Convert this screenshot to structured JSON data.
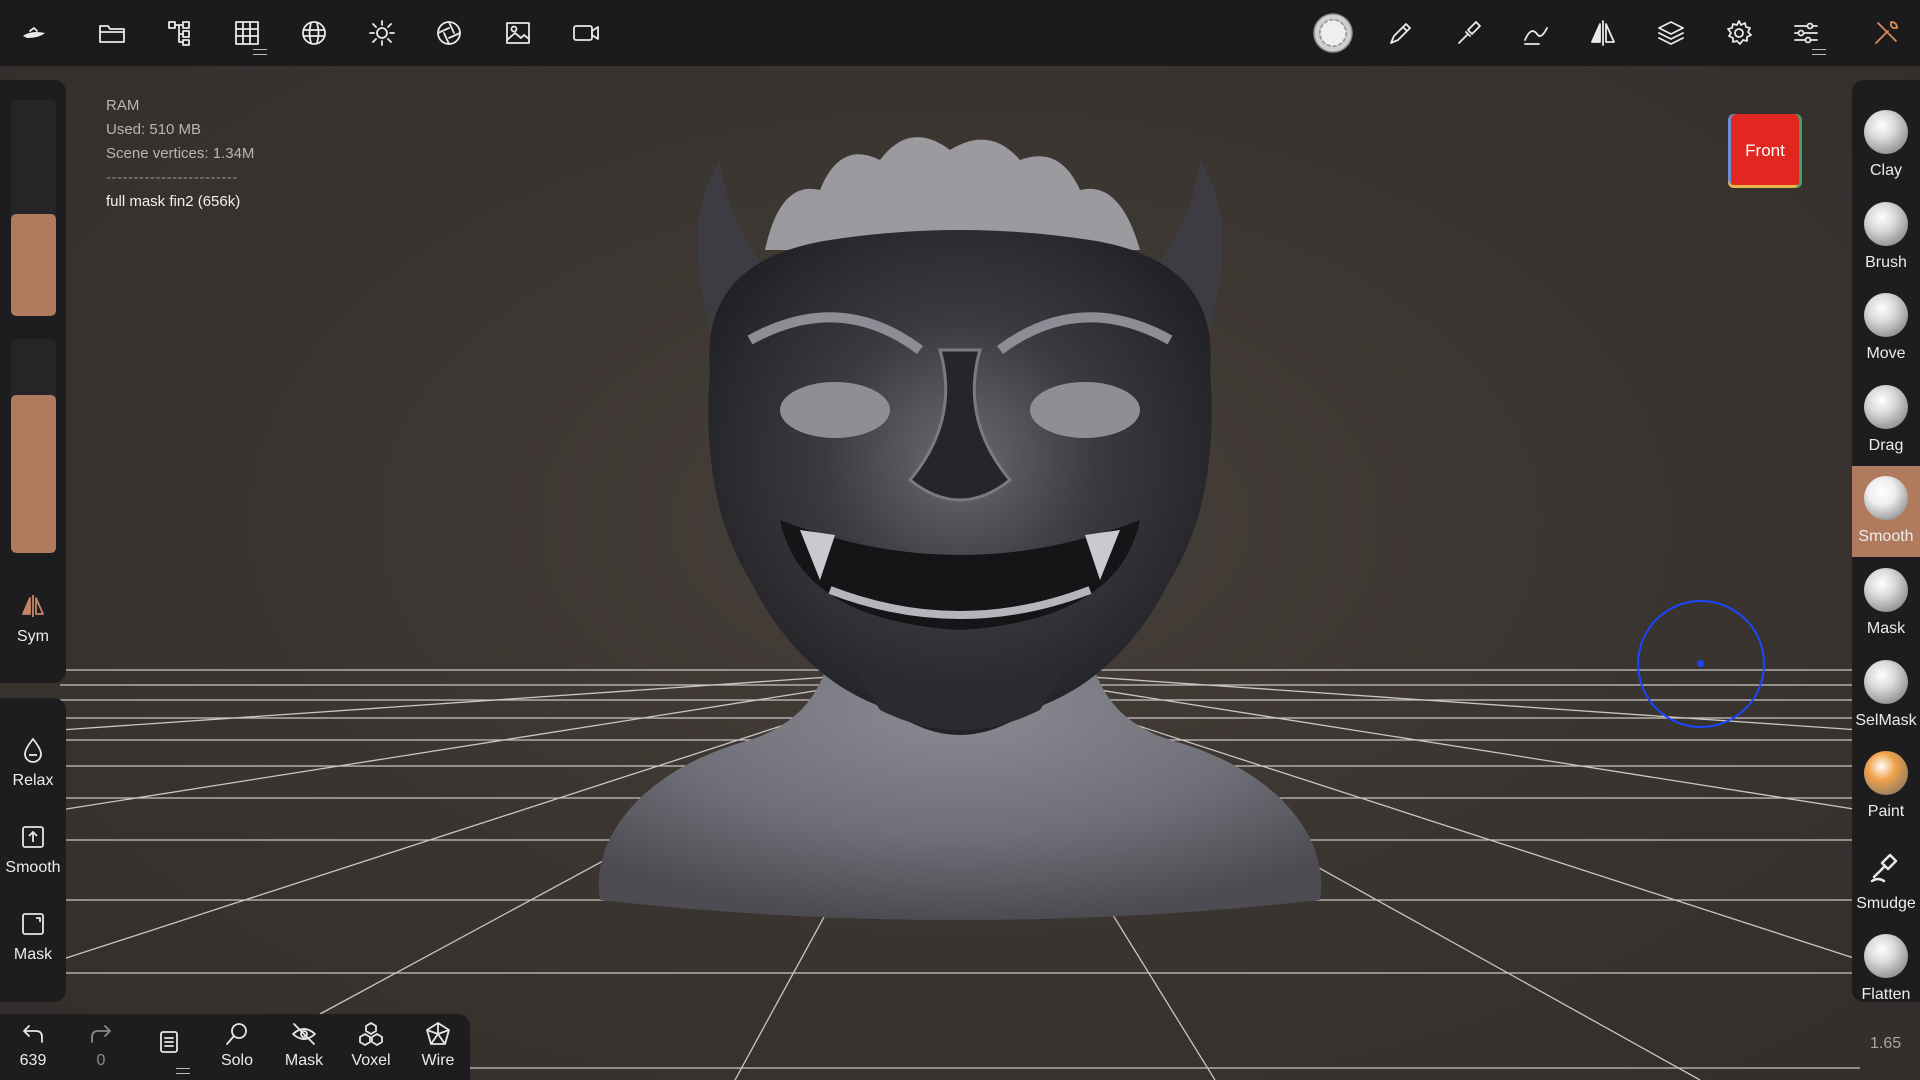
{
  "topbar": {
    "left_icons": [
      "boat-logo-icon",
      "folder-icon",
      "scene-tree-icon",
      "grid-mesh-icon",
      "sphere-topology-icon",
      "sun-icon",
      "aperture-icon",
      "image-icon",
      "video-camera-icon"
    ],
    "right_icons": [
      "material-sphere-icon",
      "pen-icon",
      "brush-tool-icon",
      "stroke-icon",
      "symmetry-icon",
      "layers-icon",
      "settings-icon",
      "sliders-icon",
      "tools-icon"
    ]
  },
  "hud": {
    "ram": "RAM",
    "used": "Used: 510 MB",
    "vertices": "Scene vertices: 1.34M",
    "separator": "------------------------",
    "object": "full mask fin2 (656k)"
  },
  "left_panel": {
    "size_slider": 0.47,
    "intensity_slider": 0.74,
    "sym_label": "Sym",
    "relax_label": "Relax",
    "smooth_label": "Smooth",
    "mask_label": "Mask"
  },
  "bottom_bar": {
    "undo_count": "639",
    "redo_count": "0",
    "solo_label": "Solo",
    "mask_label": "Mask",
    "voxel_label": "Voxel",
    "wire_label": "Wire"
  },
  "right_tools": [
    {
      "label": "Clay",
      "color": "#d9d9d9"
    },
    {
      "label": "Brush",
      "color": "#d9d9d9"
    },
    {
      "label": "Move",
      "color": "#d9d9d9"
    },
    {
      "label": "Drag",
      "color": "#d9d9d9"
    },
    {
      "label": "Smooth",
      "color": "#eeeeee",
      "active": true
    },
    {
      "label": "Mask",
      "color": "#d9d9d9"
    },
    {
      "label": "SelMask",
      "color": "#d9d9d9"
    },
    {
      "label": "Paint",
      "color": "#f0a24a"
    },
    {
      "label": "Smudge",
      "color": "#d9d9d9"
    },
    {
      "label": "Flatten",
      "color": "#d9d9d9"
    }
  ],
  "view": {
    "front_label": "Front",
    "zoom": "1.65",
    "accent": "#b07a5e",
    "cursor_color": "#1a47ff"
  }
}
